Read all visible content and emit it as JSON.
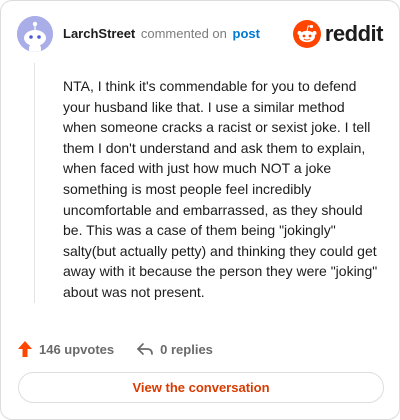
{
  "header": {
    "username": "LarchStreet",
    "action_text": "commented on",
    "post_link": "post",
    "brand": "reddit"
  },
  "comment": {
    "body": "NTA, I think it's commendable for you to defend your husband like that. I use a similar method when someone cracks a racist or sexist joke. I tell them I don't understand and ask them to explain, when faced with just how much NOT a joke something is most people feel incredibly uncomfortable and embarrassed, as they should be. This was a case of them being \"jokingly\" salty(but actually petty) and thinking they could get away with it because the person they were \"joking\" about was not present."
  },
  "stats": {
    "upvotes": "146 upvotes",
    "replies": "0 replies"
  },
  "actions": {
    "view_conversation": "View the conversation"
  },
  "colors": {
    "accent": "#ff4500",
    "link": "#0079d3",
    "button_text": "#d93a00",
    "avatar_bg": "#a9aee8"
  },
  "icons": {
    "avatar": "snoo-avatar-icon",
    "brand": "reddit-logo-icon",
    "upvote": "upvote-arrow-icon",
    "reply": "reply-arrow-icon"
  }
}
